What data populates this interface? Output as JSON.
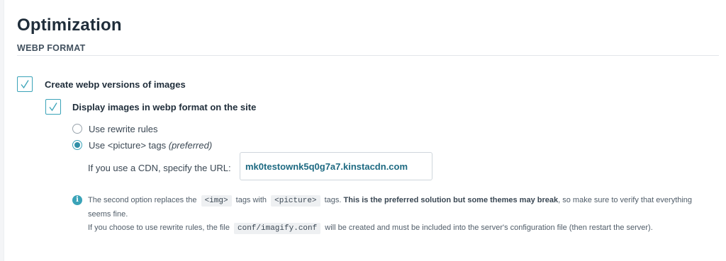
{
  "page": {
    "title": "Optimization",
    "section_title": "WEBP FORMAT"
  },
  "options": {
    "create_webp": {
      "label": "Create webp versions of images",
      "checked": true
    },
    "display_webp": {
      "label": "Display images in webp format on the site",
      "checked": true
    },
    "radio_rewrite": {
      "label": "Use rewrite rules",
      "selected": false
    },
    "radio_picture": {
      "label_main": "Use <picture> tags",
      "label_pref": "(preferred)",
      "selected": true
    }
  },
  "cdn": {
    "label": "If you use a CDN, specify the URL:",
    "value": "mk0testownk5q0g7a7.kinstacdn.com"
  },
  "note": {
    "icon": "info-icon",
    "line1_a": "The second option replaces the",
    "code_img": "<img>",
    "line1_b": "tags with",
    "code_picture": "<picture>",
    "line1_c": "tags.",
    "line1_bold": "This is the preferred solution but some themes may break",
    "line1_d": ", so make sure to verify that everything seems fine.",
    "line2_a": "If you choose to use rewrite rules, the file",
    "code_conf": "conf/imagify.conf",
    "line2_b": "will be created and must be included into the server's configuration file (then restart the server)."
  },
  "colors": {
    "accent": "#3aa3b8",
    "heading": "#1f2d3a",
    "cdn_value": "#1e6a82"
  }
}
